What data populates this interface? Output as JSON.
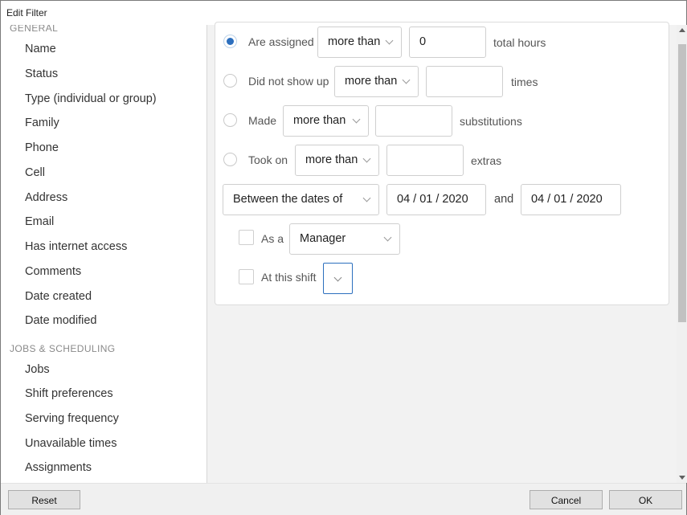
{
  "window": {
    "title": "Edit Filter"
  },
  "sidebar": {
    "sections": [
      {
        "heading": "GENERAL",
        "items": [
          "Name",
          "Status",
          "Type (individual or group)",
          "Family",
          "Phone",
          "Cell",
          "Address",
          "Email",
          "Has internet access",
          "Comments",
          "Date created",
          "Date modified"
        ]
      },
      {
        "heading": "JOBS & SCHEDULING",
        "items": [
          "Jobs",
          "Shift preferences",
          "Serving frequency",
          "Unavailable times",
          "Assignments"
        ]
      }
    ]
  },
  "filter": {
    "rows": [
      {
        "label": "Are assigned",
        "comparator": "more than",
        "value": "0",
        "unit": "total hours",
        "selected": true
      },
      {
        "label": "Did not show up",
        "comparator": "more than",
        "value": "",
        "unit": "times",
        "selected": false
      },
      {
        "label": "Made",
        "comparator": "more than",
        "value": "",
        "unit": "substitutions",
        "selected": false
      },
      {
        "label": "Took on",
        "comparator": "more than",
        "value": "",
        "unit": "extras",
        "selected": false
      }
    ],
    "date_range": {
      "mode": "Between the dates of",
      "start": "04 / 01 / 2020",
      "conjunction": "and",
      "end": "04 / 01 / 2020"
    },
    "as_a": {
      "label": "As a",
      "role": "Manager",
      "checked": false
    },
    "at_shift": {
      "label": "At this shift",
      "value": "",
      "checked": false
    }
  },
  "footer": {
    "reset": "Reset",
    "cancel": "Cancel",
    "ok": "OK"
  },
  "colors": {
    "accent": "#2c6fbe",
    "panel_bg": "#f2f2f2",
    "border": "#cfcfcf"
  }
}
